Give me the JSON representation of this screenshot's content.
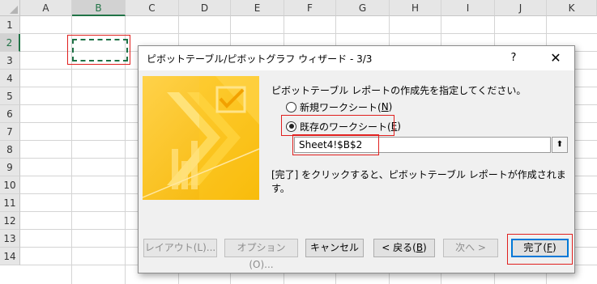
{
  "sheet": {
    "columns": [
      "A",
      "B",
      "C",
      "D",
      "E",
      "F",
      "G",
      "H",
      "I",
      "J",
      "K"
    ],
    "rows": [
      "1",
      "2",
      "3",
      "4",
      "5",
      "6",
      "7",
      "8",
      "9",
      "10",
      "11",
      "12",
      "13",
      "14"
    ],
    "active_column": "B",
    "active_row": "2"
  },
  "dialog": {
    "title": "ピボットテーブル/ピボットグラフ ウィザード - 3/3",
    "help": "?",
    "close": "✕",
    "prompt": "ピボットテーブル レポートの作成先を指定してください。",
    "radio_new": {
      "label": "新規ワークシート(",
      "key": "N",
      "tail": ")",
      "selected": false
    },
    "radio_existing": {
      "label": "既存のワークシート(",
      "key": "E",
      "tail": ")",
      "selected": true
    },
    "range_value": "Sheet4!$B$2",
    "collapse_icon": "upload-arrow-icon",
    "info": "[完了] をクリックすると、ピボットテーブル レポートが作成されます。",
    "buttons": {
      "layout": "レイアウト(L)...",
      "options": "オプション(O)...",
      "cancel": "キャンセル",
      "back_label": "< 戻る(",
      "back_key": "B",
      "back_tail": ")",
      "next": "次へ >",
      "finish_label": "完了(",
      "finish_key": "F",
      "finish_tail": ")"
    }
  },
  "colors": {
    "accent_green": "#217346",
    "highlight_red": "#e0201e",
    "illustration_yellow": "#ffc90e"
  }
}
